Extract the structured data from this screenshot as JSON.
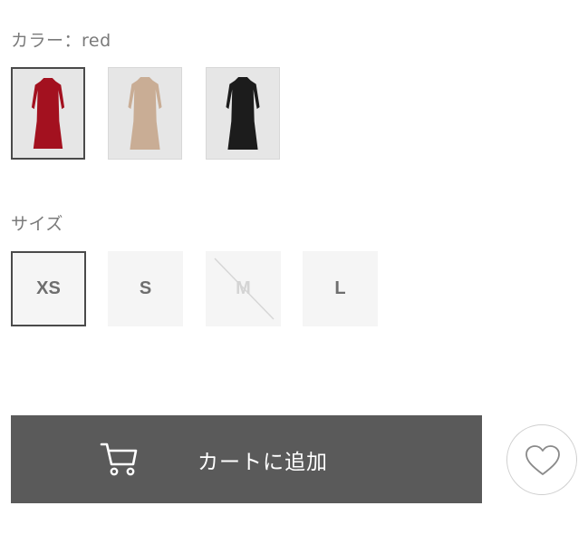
{
  "color_section": {
    "label": "カラー：red",
    "swatches": [
      {
        "name": "red",
        "dress_color": "#a3111f",
        "selected": true
      },
      {
        "name": "beige",
        "dress_color": "#c9ad95",
        "selected": false
      },
      {
        "name": "black",
        "dress_color": "#1c1c1c",
        "selected": false
      }
    ]
  },
  "size_section": {
    "label": "サイズ",
    "sizes": [
      {
        "label": "XS",
        "state": "selected"
      },
      {
        "label": "S",
        "state": "available"
      },
      {
        "label": "M",
        "state": "sold-out"
      },
      {
        "label": "L",
        "state": "available"
      }
    ]
  },
  "actions": {
    "add_to_cart_label": "カートに追加",
    "cart_icon": "cart-icon",
    "favorite_icon": "heart-icon"
  },
  "colors": {
    "cart_button_bg": "#5a5a5a",
    "selected_border": "#4a4a4a",
    "size_bg": "#f5f5f5"
  }
}
